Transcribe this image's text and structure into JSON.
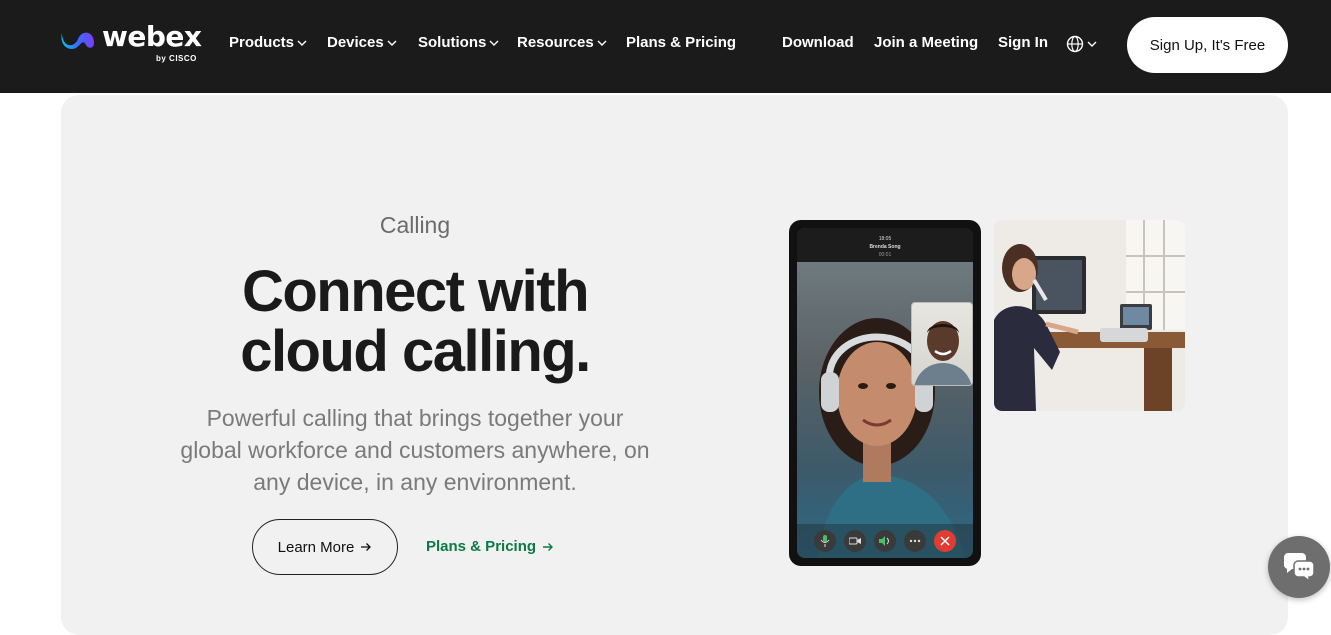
{
  "brand": {
    "name": "webex",
    "sub": "by CISCO"
  },
  "nav": {
    "items": [
      {
        "label": "Products",
        "dropdown": true
      },
      {
        "label": "Devices",
        "dropdown": true
      },
      {
        "label": "Solutions",
        "dropdown": true
      },
      {
        "label": "Resources",
        "dropdown": true
      },
      {
        "label": "Plans & Pricing",
        "dropdown": false
      }
    ],
    "right": [
      {
        "label": "Download"
      },
      {
        "label": "Join a Meeting"
      },
      {
        "label": "Sign In"
      }
    ],
    "cta": "Sign Up, It's Free"
  },
  "hero": {
    "eyebrow": "Calling",
    "headline_line1": "Connect with",
    "headline_line2": "cloud calling.",
    "sub_line1": "Powerful calling that brings together your",
    "sub_line2": "global workforce and customers anywhere, on",
    "sub_line3": "any device, in any environment.",
    "primary_button": "Learn More",
    "secondary_link": "Plans & Pricing"
  },
  "phone": {
    "time": "18:05",
    "caller": "Brenda Song",
    "duration": "00:01"
  },
  "colors": {
    "nav_bg": "#1b1b1b",
    "hero_bg": "#f1f1f1",
    "link_green": "#0b7a43",
    "end_call_red": "#e03c31"
  }
}
